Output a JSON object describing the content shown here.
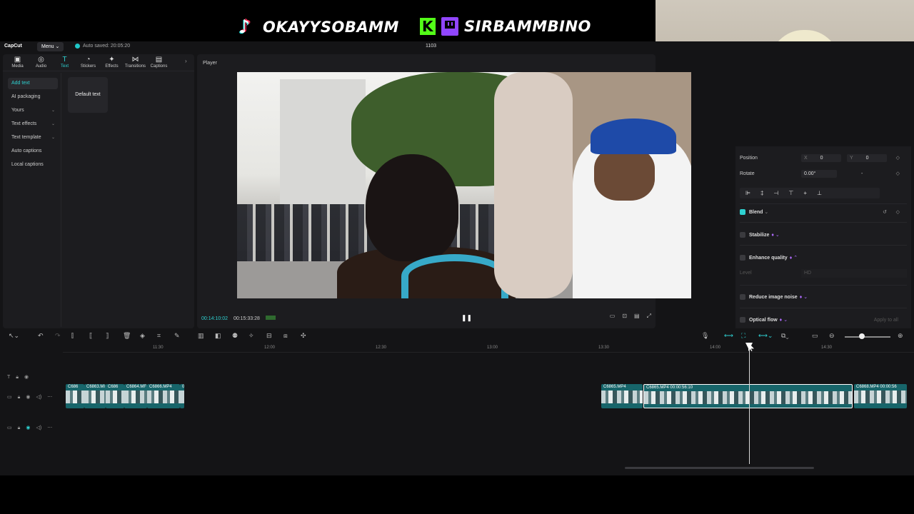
{
  "overlay": {
    "tiktok_handle": "OKAYYSOBAMM",
    "twitch_handle": "SIRBAMMBINO",
    "kick_letter": "K"
  },
  "app": {
    "logo": "CapCut",
    "menu_label": "Menu",
    "autosave": "Auto saved: 20:05:20",
    "project_name": "1103"
  },
  "left_panel": {
    "tabs": [
      {
        "icon": "▣",
        "label": "Media"
      },
      {
        "icon": "◎",
        "label": "Audio"
      },
      {
        "icon": "T",
        "label": "Text"
      },
      {
        "icon": "◔",
        "label": "Stickers"
      },
      {
        "icon": "✦",
        "label": "Effects"
      },
      {
        "icon": "⋈",
        "label": "Transitions"
      },
      {
        "icon": "▤",
        "label": "Captions"
      }
    ],
    "categories": [
      {
        "label": "Add text",
        "caret": ""
      },
      {
        "label": "AI packaging",
        "caret": ""
      },
      {
        "label": "Yours",
        "caret": "⌄"
      },
      {
        "label": "Text effects",
        "caret": "⌄"
      },
      {
        "label": "Text template",
        "caret": "⌄"
      },
      {
        "label": "Auto captions",
        "caret": ""
      },
      {
        "label": "Local captions",
        "caret": ""
      }
    ],
    "default_text_card": "Default text"
  },
  "player": {
    "title": "Player",
    "current_time": "00:14:10:02",
    "total_time": "00:15:33:28"
  },
  "inspector": {
    "position_label": "Position",
    "pos_x_axis": "X",
    "pos_x": "0",
    "pos_y_axis": "Y",
    "pos_y": "0",
    "rotate_label": "Rotate",
    "rotate_value": "0.00°",
    "rotate_dash": "-",
    "blend_label": "Blend",
    "stabilize_label": "Stabilize",
    "enhance_label": "Enhance quality",
    "level_label": "Level",
    "level_value": "HD",
    "reduce_noise_label": "Reduce image noise",
    "optical_flow_label": "Optical flow",
    "apply_all": "Apply to all"
  },
  "timeline": {
    "ruler": [
      "11:30",
      "12:00",
      "12:30",
      "13:00",
      "13:30",
      "14:00",
      "14:30"
    ],
    "clips_left": [
      {
        "label": "C686"
      },
      {
        "label": "C6863.MI"
      },
      {
        "label": "C686"
      },
      {
        "label": "C6864.MF"
      },
      {
        "label": "C6866.MP4"
      },
      {
        "label": "0"
      }
    ],
    "clips_right": [
      {
        "label": "C6865.MP4"
      },
      {
        "label": "C6865.MP4   00:00:56:10"
      },
      {
        "label": "C6868.MP4   00:00:56"
      }
    ]
  }
}
